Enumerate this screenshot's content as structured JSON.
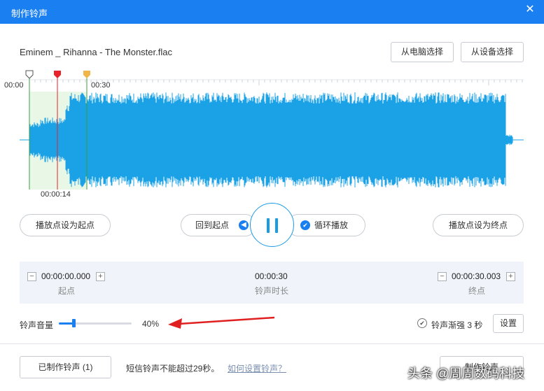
{
  "window": {
    "title": "制作铃声",
    "close_glyph": "✕"
  },
  "file": {
    "name": "Eminem _ Rihanna - The Monster.flac"
  },
  "buttons": {
    "from_pc": "从电脑选择",
    "from_device": "从设备选择"
  },
  "timeline": {
    "start_label": "00:00",
    "end_label": "00:30",
    "current_label": "00:00:14"
  },
  "playback": {
    "set_start": "播放点设为起点",
    "set_end": "播放点设为终点",
    "back_to_start": "回到起点",
    "loop": "循环播放",
    "state": "playing"
  },
  "times": {
    "start": {
      "value": "00:00:00.000",
      "label": "起点"
    },
    "duration": {
      "value": "00:00:30",
      "label": "铃声时长"
    },
    "end": {
      "value": "00:00:30.003",
      "label": "终点"
    }
  },
  "volume": {
    "label": "铃声音量",
    "percent_text": "40%",
    "level": 0.2
  },
  "fade": {
    "label": "铃声渐强 3 秒",
    "checked": true,
    "settings_button": "设置"
  },
  "footer": {
    "made_button": "已制作铃声 (1)",
    "sms_note": "短信铃声不能超过29秒。",
    "help_link": "如何设置铃声？",
    "right_button": "制作铃声"
  },
  "watermark": "头条 @周周数码科技",
  "colors": {
    "accent": "#1a7ff0",
    "waveform": "#1aa1e6",
    "start_marker": "#e8222a",
    "end_marker": "#f0b64a",
    "arrow": "#e02020"
  },
  "icons": {
    "close": "close-icon",
    "home": "back-arrow-icon",
    "loop": "check-icon",
    "fade": "check-circle-icon",
    "pause": "pause-icon"
  }
}
